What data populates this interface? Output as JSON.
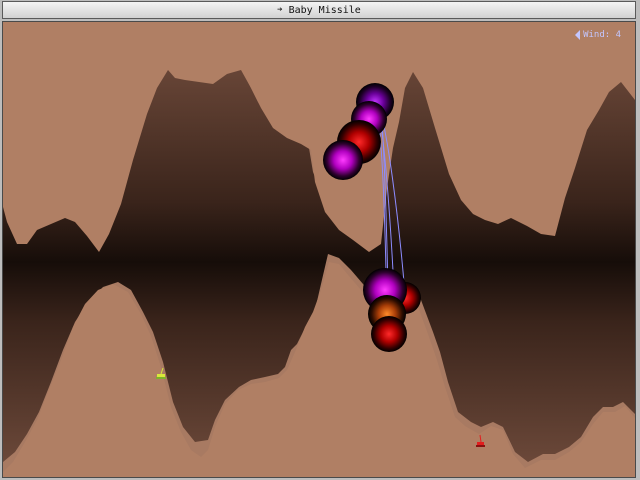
{
  "window": {
    "weapon_name": "Baby Missile",
    "weapon_icon": "missile-icon"
  },
  "hud": {
    "wind_label": "Wind: 4",
    "wind_direction": "left"
  },
  "colors": {
    "sky": "#a87a62",
    "terrain": "#b07f64",
    "cavern": "#1a0f0b",
    "trajectory": "#8d8cff",
    "player_tank": "#d8e93a",
    "enemy_tank": "#e11e1e"
  },
  "entities": {
    "player_tank": {
      "name": "player",
      "color": "#d8e93a"
    },
    "enemy_tank": {
      "name": "enemy",
      "color": "#e11e1e"
    }
  }
}
